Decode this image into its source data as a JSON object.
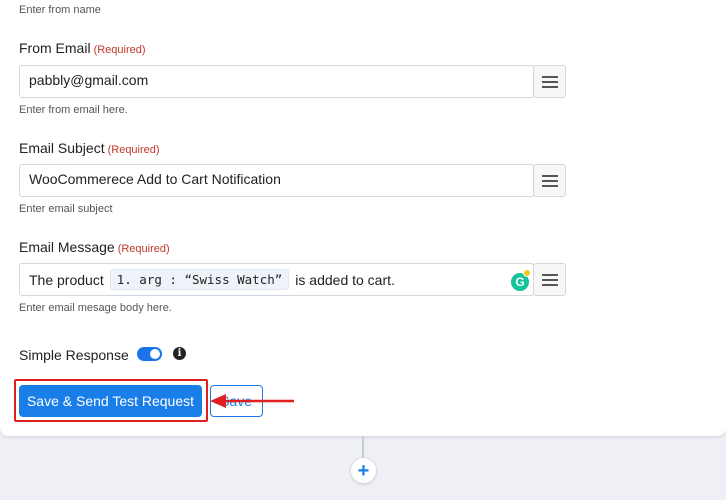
{
  "form": {
    "from_name_hint": "Enter from name",
    "from_email": {
      "label": "From Email",
      "required": "(Required)",
      "value": "pabbly@gmail.com",
      "hint": "Enter from email here."
    },
    "email_subject": {
      "label": "Email Subject",
      "required": "(Required)",
      "value": "WooCommerece Add to Cart Notification",
      "hint": "Enter email subject"
    },
    "email_message": {
      "label": "Email Message",
      "required": "(Required)",
      "text_before": "The product",
      "chip": "1. arg : “Swiss Watch”",
      "text_after": "is added to cart.",
      "hint": "Enter email mesage body here."
    },
    "simple_response": {
      "label": "Simple Response",
      "enabled": true
    }
  },
  "actions": {
    "primary_label": "Save & Send Test Request",
    "save_label": "Save"
  },
  "icons": {
    "field_menu": "hamburger-menu-icon",
    "grammarly": "grammarly-icon",
    "grammarly_letter": "G",
    "info": "info-icon",
    "info_glyph": "i",
    "add_step": "plus-icon",
    "add_glyph": "+"
  },
  "colors": {
    "primary": "#1a7ee8",
    "required": "#c0392b",
    "highlight": "#e02020",
    "grammarly": "#15c39a"
  }
}
